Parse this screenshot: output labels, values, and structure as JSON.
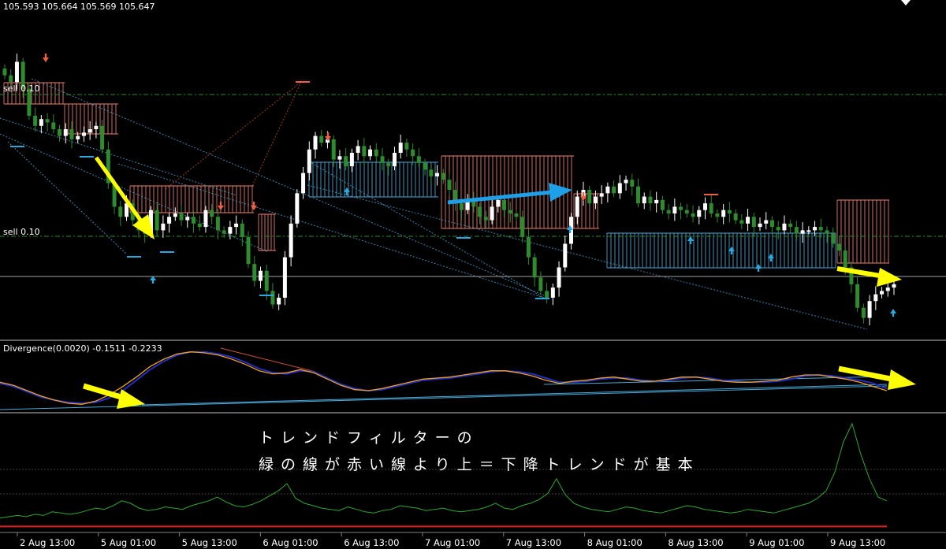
{
  "ohlc_readout": "105.593 105.664 105.569 105.647",
  "level_labels": [
    "sell 0.10",
    "sell 0.10"
  ],
  "divergence_label": "Divergence(0.0020) -0.1511 -0.2233",
  "annotation": {
    "line1": "トレンドフィルターの",
    "line2": "緑の線が赤い線より上＝下降トレンドが基本"
  },
  "chart_data": {
    "type": "line",
    "x_ticks": [
      "2 Aug 13:00",
      "5 Aug 01:00",
      "5 Aug 13:00",
      "6 Aug 01:00",
      "6 Aug 13:00",
      "7 Aug 01:00",
      "7 Aug 13:00",
      "8 Aug 01:00",
      "8 Aug 13:00",
      "9 Aug 01:00",
      "9 Aug 13:00"
    ],
    "grid": false,
    "colors": {
      "bull_candle": "#ffffff",
      "bear_candle": "#2e8b2e",
      "cloud_bear": "#f08070",
      "cloud_bull": "#4aa8d8",
      "buy_arrow": "#29a8e0",
      "sell_arrow": "#f06040",
      "osc_blue": "#2030c0",
      "osc_orange": "#f0a020",
      "filter_green": "#2ea82e",
      "filter_red": "#e02020",
      "annotation_arrow_yellow": "#ffff00",
      "annotation_arrow_blue": "#1ea0e8"
    },
    "price": {
      "closes": [
        105.62,
        105.6,
        105.66,
        105.58,
        105.5,
        105.47,
        105.49,
        105.48,
        105.46,
        105.44,
        105.46,
        105.43,
        105.44,
        105.45,
        105.46,
        105.47,
        105.4,
        105.3,
        105.23,
        105.2,
        105.24,
        105.19,
        105.16,
        105.15,
        105.22,
        105.16,
        105.18,
        105.2,
        105.21,
        105.19,
        105.2,
        105.18,
        105.17,
        105.22,
        105.2,
        105.16,
        105.15,
        105.17,
        105.18,
        105.14,
        105.06,
        105.01,
        105.04,
        104.98,
        104.94,
        104.96,
        105.08,
        105.18,
        105.27,
        105.33,
        105.4,
        105.44,
        105.42,
        105.43,
        105.37,
        105.38,
        105.35,
        105.39,
        105.41,
        105.38,
        105.4,
        105.38,
        105.36,
        105.35,
        105.39,
        105.42,
        105.4,
        105.38,
        105.36,
        105.34,
        105.32,
        105.33,
        105.31,
        105.28,
        105.24,
        105.22,
        105.25,
        105.23,
        105.2,
        105.19,
        105.23,
        105.25,
        105.22,
        105.21,
        105.2,
        105.14,
        105.08,
        105.02,
        104.98,
        104.96,
        104.99,
        105.05,
        105.12,
        105.2,
        105.26,
        105.28,
        105.24,
        105.26,
        105.27,
        105.29,
        105.27,
        105.3,
        105.31,
        105.29,
        105.24,
        105.26,
        105.24,
        105.25,
        105.22,
        105.21,
        105.23,
        105.22,
        105.21,
        105.2,
        105.22,
        105.24,
        105.21,
        105.2,
        105.22,
        105.21,
        105.19,
        105.18,
        105.2,
        105.17,
        105.18,
        105.19,
        105.17,
        105.16,
        105.18,
        105.17,
        105.15,
        105.16,
        105.16,
        105.17,
        105.16,
        105.15,
        105.12,
        105.1,
        105.05,
        105.0,
        104.93,
        104.9,
        104.95,
        104.97,
        104.98,
        104.99,
        105.0
      ]
    },
    "divergence": {
      "blue": [
        -0.15,
        -0.18,
        -0.23,
        -0.28,
        -0.31,
        -0.33,
        -0.34,
        -0.33,
        -0.29,
        -0.22,
        -0.12,
        -0.02,
        0.06,
        0.12,
        0.15,
        0.15,
        0.13,
        0.1,
        0.05,
        -0.01,
        -0.05,
        -0.06,
        -0.03,
        -0.04,
        -0.1,
        -0.16,
        -0.2,
        -0.22,
        -0.21,
        -0.18,
        -0.15,
        -0.12,
        -0.11,
        -0.1,
        -0.08,
        -0.06,
        -0.04,
        -0.03,
        -0.04,
        -0.06,
        -0.1,
        -0.14,
        -0.14,
        -0.13,
        -0.11,
        -0.1,
        -0.1,
        -0.12,
        -0.13,
        -0.12,
        -0.1,
        -0.09,
        -0.1,
        -0.12,
        -0.13,
        -0.14,
        -0.14,
        -0.13,
        -0.11,
        -0.08,
        -0.07,
        -0.08,
        -0.1,
        -0.12,
        -0.15,
        -0.2
      ],
      "orange": [
        -0.14,
        -0.17,
        -0.22,
        -0.27,
        -0.31,
        -0.34,
        -0.35,
        -0.32,
        -0.26,
        -0.18,
        -0.09,
        0.01,
        0.08,
        0.13,
        0.15,
        0.14,
        0.12,
        0.08,
        0.03,
        -0.03,
        -0.06,
        -0.05,
        -0.02,
        -0.05,
        -0.11,
        -0.17,
        -0.21,
        -0.22,
        -0.2,
        -0.17,
        -0.14,
        -0.11,
        -0.1,
        -0.09,
        -0.07,
        -0.05,
        -0.03,
        -0.03,
        -0.05,
        -0.08,
        -0.12,
        -0.15,
        -0.13,
        -0.12,
        -0.1,
        -0.09,
        -0.11,
        -0.13,
        -0.13,
        -0.11,
        -0.09,
        -0.09,
        -0.11,
        -0.13,
        -0.14,
        -0.14,
        -0.13,
        -0.12,
        -0.09,
        -0.07,
        -0.07,
        -0.09,
        -0.11,
        -0.14,
        -0.18,
        -0.22
      ],
      "ylim": [
        -0.4,
        0.2
      ]
    },
    "trend_filter": {
      "green": [
        8,
        9,
        10,
        9,
        11,
        10,
        13,
        12,
        11,
        12,
        14,
        16,
        15,
        18,
        22,
        20,
        16,
        14,
        15,
        17,
        16,
        15,
        18,
        20,
        22,
        25,
        21,
        18,
        17,
        19,
        22,
        26,
        30,
        36,
        24,
        20,
        18,
        16,
        15,
        14,
        17,
        15,
        13,
        12,
        14,
        15,
        18,
        17,
        16,
        14,
        15,
        16,
        14,
        13,
        14,
        15,
        17,
        20,
        16,
        15,
        18,
        20,
        23,
        28,
        40,
        27,
        20,
        17,
        15,
        14,
        13,
        15,
        17,
        16,
        14,
        13,
        12,
        14,
        16,
        18,
        17,
        15,
        14,
        13,
        12,
        13,
        15,
        14,
        13,
        12,
        14,
        16,
        18,
        20,
        24,
        30,
        45,
        70,
        85,
        60,
        40,
        25,
        22
      ],
      "red": [
        1,
        1,
        1,
        1,
        1,
        1,
        1,
        1,
        1,
        1,
        1,
        1,
        1,
        1,
        1,
        1,
        1,
        1,
        1,
        1,
        1,
        1,
        1,
        1,
        1,
        1,
        1,
        1,
        1,
        1,
        1,
        1,
        1,
        1,
        1,
        1,
        1,
        1,
        1,
        1,
        1,
        1,
        1,
        1,
        1,
        1,
        1,
        1,
        1,
        1,
        1,
        1,
        1,
        1,
        1,
        1,
        1,
        1,
        1,
        1,
        1,
        1,
        1,
        1,
        1,
        1,
        1,
        1,
        1,
        1,
        1,
        1,
        1,
        1,
        1,
        1,
        1,
        1,
        1,
        1,
        1,
        1,
        1,
        1,
        1,
        1,
        1,
        1,
        1,
        1,
        1,
        1,
        1,
        1,
        1,
        1,
        1,
        1,
        1,
        1,
        1,
        1,
        1
      ]
    }
  }
}
